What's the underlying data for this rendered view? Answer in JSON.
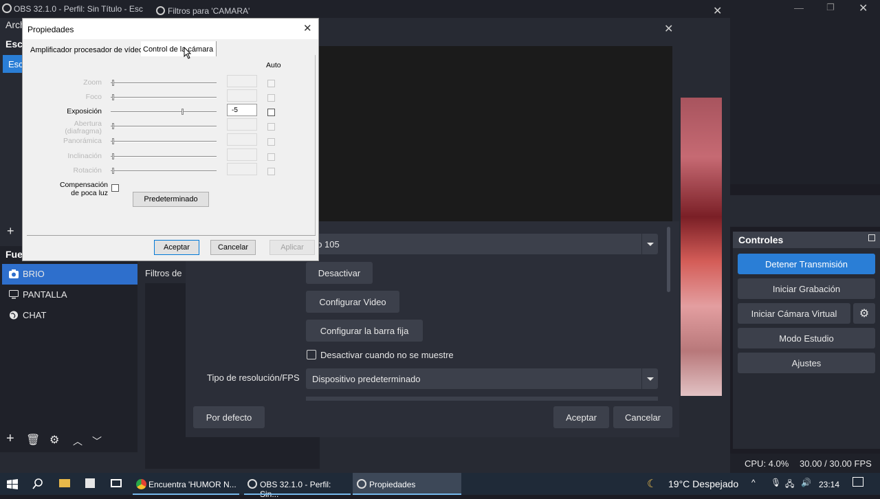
{
  "obs": {
    "title": "OBS 32.1.0 - Perfil: Sin Título - Esc",
    "menu_first": "Arch",
    "scenes_head": "Esce",
    "scene_item": "Esc",
    "sources_head": "Fue",
    "sources": [
      {
        "label": "BRIO",
        "icon": "camera-icon"
      },
      {
        "label": "PANTALLA",
        "icon": "monitor-icon"
      },
      {
        "label": "CHAT",
        "icon": "globe-icon"
      }
    ]
  },
  "filters_window": {
    "title": "Filtros para 'CAMARA'",
    "filters_label": "Filtros de",
    "device_select": "rio 105",
    "btn_deactivate": "Desactivar",
    "btn_config_video": "Configurar Video",
    "btn_config_bar": "Configurar la barra fija",
    "checkbox_label": "Desactivar cuando no se muestre",
    "res_label": "Tipo de resolución/FPS",
    "res_select": "Dispositivo predeterminado",
    "btn_defaults": "Por defecto",
    "btn_accept": "Aceptar",
    "btn_cancel": "Cancelar"
  },
  "controls": {
    "title": "Controles",
    "buttons": [
      "Detener Transmisión",
      "Iniciar Grabación",
      "Iniciar Cámara Virtual",
      "Modo Estudio",
      "Ajustes"
    ]
  },
  "status": {
    "cpu": "CPU: 4.0%",
    "fps": "30.00 / 30.00 FPS"
  },
  "properties_dialog": {
    "title": "Propiedades",
    "tab1": "Amplificador procesador de vídeo",
    "tab2": "Control de la cámara",
    "auto_head": "Auto",
    "rows": [
      {
        "label": "Zoom",
        "value": "",
        "enabled": false,
        "knob": 0.0
      },
      {
        "label": "Foco",
        "value": "",
        "enabled": false,
        "knob": 0.0
      },
      {
        "label": "Exposición",
        "value": "-5",
        "enabled": true,
        "knob": 0.67
      },
      {
        "label": "Abertura\n(diafragma)",
        "value": "",
        "enabled": false,
        "knob": 0.0
      },
      {
        "label": "Panorámica",
        "value": "",
        "enabled": false,
        "knob": 0.0
      },
      {
        "label": "Inclinación",
        "value": "",
        "enabled": false,
        "knob": 0.0
      },
      {
        "label": "Rotación",
        "value": "",
        "enabled": false,
        "knob": 0.0
      }
    ],
    "lowlight_label_1": "Compensación",
    "lowlight_label_2": "de poca luz",
    "btn_default": "Predeterminado",
    "btn_accept": "Aceptar",
    "btn_cancel": "Cancelar",
    "btn_apply": "Aplicar"
  },
  "taskbar": {
    "apps": [
      {
        "label": "Encuentra 'HUMOR N...",
        "icon": "chrome-icon"
      },
      {
        "label": "OBS 32.1.0 - Perfil: Sin...",
        "icon": "obs-icon"
      },
      {
        "label": "Propiedades",
        "icon": "obs-icon"
      }
    ],
    "weather": "19°C  Despejado",
    "time": "23:14"
  },
  "colors": {
    "accent": "#2a7ed6",
    "dark_bg": "#272a33"
  }
}
